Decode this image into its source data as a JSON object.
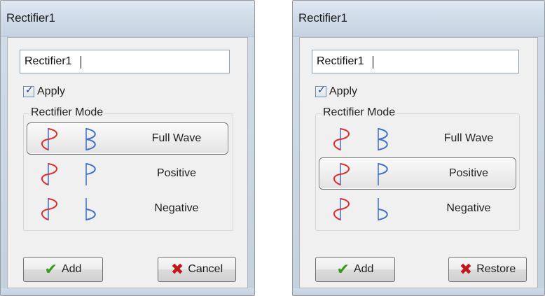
{
  "dialogs": [
    {
      "title": "Rectifier1",
      "name_value": "Rectifier1",
      "apply_label": "Apply",
      "apply_checked": true,
      "group_label": "Rectifier Mode",
      "modes": [
        {
          "label": "Full Wave",
          "selected": true
        },
        {
          "label": "Positive",
          "selected": false
        },
        {
          "label": "Negative",
          "selected": false
        }
      ],
      "add_label": "Add",
      "secondary_label": "Cancel"
    },
    {
      "title": "Rectifier1",
      "name_value": "Rectifier1",
      "apply_label": "Apply",
      "apply_checked": true,
      "group_label": "Rectifier Mode",
      "modes": [
        {
          "label": "Full Wave",
          "selected": false
        },
        {
          "label": "Positive",
          "selected": true
        },
        {
          "label": "Negative",
          "selected": false
        }
      ],
      "add_label": "Add",
      "secondary_label": "Restore"
    }
  ],
  "colors": {
    "input_wave": "#e02b2b",
    "output_wave": "#3d6fcc",
    "add_icon": "#3a9a1e",
    "cancel_icon": "#c3151a"
  },
  "icons": {
    "add": "checkmark-icon",
    "cancel": "x-icon",
    "input_wave": "sine-wave-icon",
    "output_full": "full-wave-rectified-icon",
    "output_positive": "positive-half-wave-icon",
    "output_negative": "negative-half-wave-icon"
  }
}
